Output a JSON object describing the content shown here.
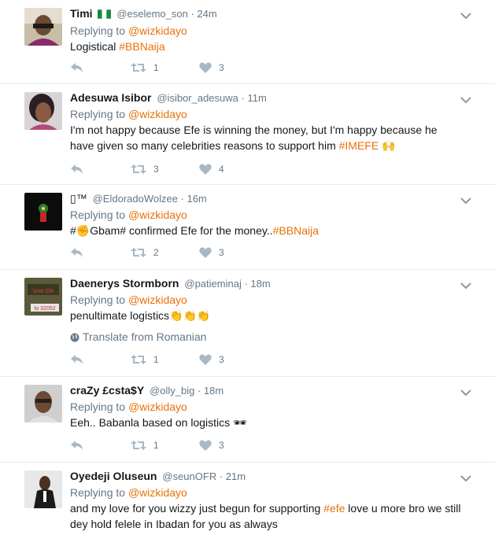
{
  "tweets": [
    {
      "name": "Timi",
      "flag": true,
      "handle": "@eselemo_son",
      "time": "24m",
      "replying_prefix": "Replying to ",
      "replying_to": "@wizkidayo",
      "text": [
        {
          "t": "Logistical "
        },
        {
          "t": "#BBNaija",
          "tag": true
        }
      ],
      "retweets": "1",
      "likes": "3",
      "avatar": "avatar-timi"
    },
    {
      "name": "Adesuwa Isibor",
      "handle": "@isibor_adesuwa",
      "time": "11m",
      "replying_prefix": "Replying to ",
      "replying_to": "@wizkidayo",
      "text": [
        {
          "t": "I'm not happy because Efe is winning the money, but I'm happy because he have given so many celebrities reasons to support him "
        },
        {
          "t": "#IMEFE",
          "tag": true
        },
        {
          "t": " 🙌"
        }
      ],
      "retweets": "3",
      "likes": "4",
      "avatar": "avatar-adesuwa"
    },
    {
      "name": "▯™",
      "name_plain": true,
      "handle": "@EldoradoWolzee",
      "time": "16m",
      "replying_prefix": "Replying to ",
      "replying_to": "@wizkidayo",
      "text": [
        {
          "t": "#✊Gbam# confirmed Efe for the money.."
        },
        {
          "t": "#BBNaija",
          "tag": true
        }
      ],
      "retweets": "2",
      "likes": "3",
      "avatar": "avatar-eldorado"
    },
    {
      "name": "Daenerys Stormborn",
      "handle": "@patieminaj",
      "time": "18m",
      "replying_prefix": "Replying to ",
      "replying_to": "@wizkidayo",
      "text": [
        {
          "t": "penultimate logistics👏👏👏"
        }
      ],
      "translate": "Translate from Romanian",
      "retweets": "1",
      "likes": "3",
      "avatar": "avatar-daenerys",
      "avatar_text": [
        "Vote Efe",
        "to 32052"
      ]
    },
    {
      "name": "craZy £csta$Y",
      "handle": "@olly_big",
      "time": "18m",
      "replying_prefix": "Replying to ",
      "replying_to": "@wizkidayo",
      "text": [
        {
          "t": "Eeh.. Babanla based on logistics 🕶"
        }
      ],
      "retweets": "1",
      "likes": "3",
      "avatar": "avatar-crazy"
    },
    {
      "name": "Oyedeji Oluseun",
      "handle": "@seunOFR",
      "time": "21m",
      "replying_prefix": "Replying to ",
      "replying_to": "@wizkidayo",
      "text": [
        {
          "t": "and my love for you wizzy just begun for supporting "
        },
        {
          "t": "#efe",
          "tag": true
        },
        {
          "t": " love u more bro we still dey hold felele in Ibadan for you as always"
        }
      ],
      "avatar": "avatar-oyedeji"
    }
  ],
  "separator": " · ",
  "colors": {
    "accent": "#e8710a",
    "muted": "#657786",
    "border": "#e6ecf0"
  },
  "icons": [
    "reply-icon",
    "retweet-icon",
    "like-icon",
    "chevron-down-icon",
    "globe-icon"
  ]
}
